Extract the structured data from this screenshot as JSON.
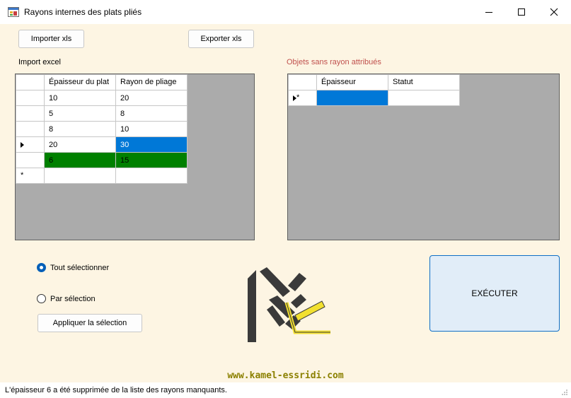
{
  "window": {
    "title": "Rayons internes des plats pliés"
  },
  "toolbar": {
    "import_label": "Importer xls",
    "export_label": "Exporter xls"
  },
  "import_grid": {
    "label": "Import excel",
    "headers": [
      "Épaisseur du plat",
      "Rayon de pliage"
    ],
    "rows": [
      {
        "epaisseur": "10",
        "rayon": "20"
      },
      {
        "epaisseur": "5",
        "rayon": "8"
      },
      {
        "epaisseur": "8",
        "rayon": "10"
      },
      {
        "epaisseur": "20",
        "rayon": "30"
      },
      {
        "epaisseur": "6",
        "rayon": "15"
      },
      {
        "epaisseur": "",
        "rayon": ""
      }
    ]
  },
  "missing_grid": {
    "label": "Objets sans rayon attribués",
    "headers": [
      "Épaisseur",
      "Statut"
    ]
  },
  "selection": {
    "all_label": "Tout sélectionner",
    "by_selection_label": "Par sélection",
    "apply_label": "Appliquer la sélection"
  },
  "execute_label": "EXÉCUTER",
  "website": "www.kamel-essridi.com",
  "status": "L'épaisseur 6 a été supprimée de la liste des rayons manquants.",
  "colors": {
    "background": "#fdf5e3",
    "selection_blue": "#0078d7",
    "highlight_green": "#008000",
    "objets_label": "#c0504d",
    "website": "#8b8000"
  }
}
